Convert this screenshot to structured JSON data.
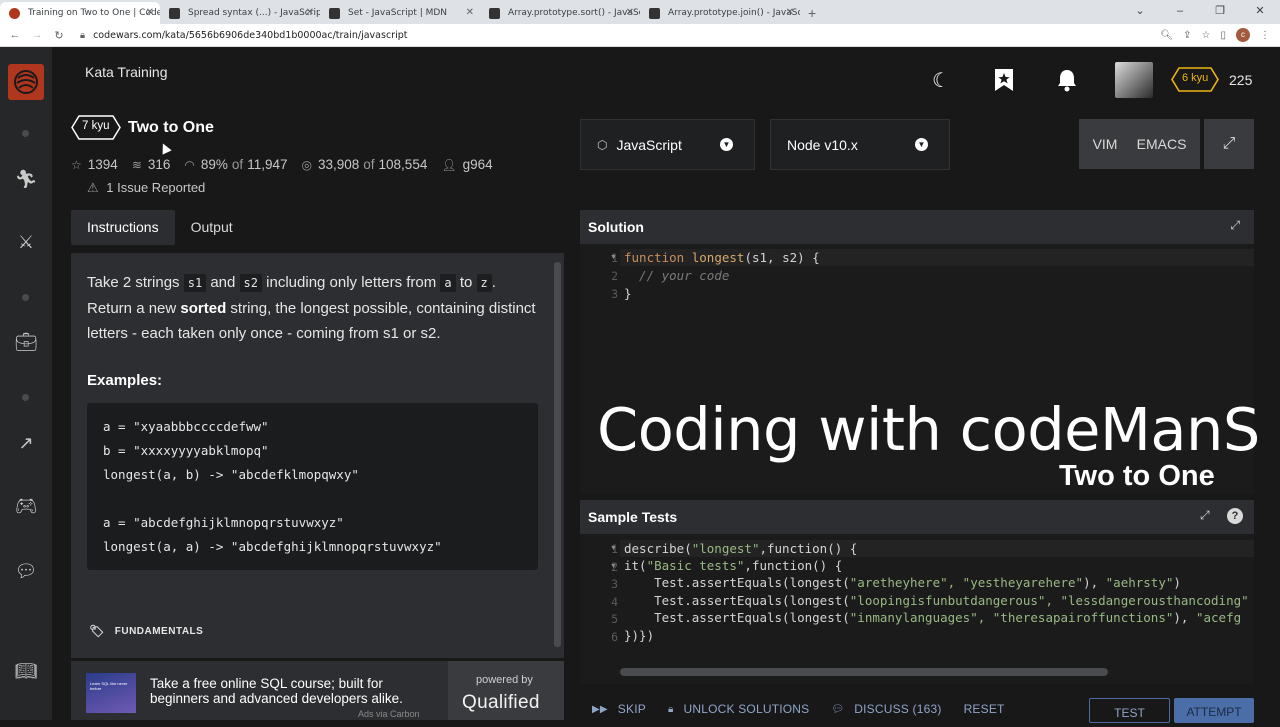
{
  "browser": {
    "tabs": [
      {
        "title": "Training on Two to One | Codewars",
        "active": true
      },
      {
        "title": "Spread syntax (...) - JavaScript | MDN",
        "active": false
      },
      {
        "title": "Set - JavaScript | MDN",
        "active": false
      },
      {
        "title": "Array.prototype.sort() - JavaScript",
        "active": false
      },
      {
        "title": "Array.prototype.join() - JavaScript",
        "active": false
      }
    ],
    "url": "codewars.com/kata/5656b6906de340bd1b0000ac/train/javascript",
    "profile_initial": "c"
  },
  "header": {
    "section_title": "Kata Training",
    "rank": "6 kyu",
    "honor": "225"
  },
  "kata": {
    "kyu": "7 kyu",
    "name": "Two to One",
    "stars": "1394",
    "collections": "316",
    "satisfaction": "89%",
    "satisfaction_of": "of",
    "satisfaction_votes": "11,947",
    "completed": "33,908",
    "completed_of": "of",
    "attempted": "108,554",
    "author": "g964",
    "issues": "1 Issue Reported"
  },
  "left_tabs": {
    "instructions": "Instructions",
    "output": "Output"
  },
  "description": {
    "p1_a": "Take 2 strings ",
    "s1": "s1",
    "p1_b": " and ",
    "s2": "s2",
    "p1_c": " including only letters from ",
    "a": "a",
    "p1_d": " to ",
    "z": "z",
    "p1_e": ".",
    "p2_a": "Return a new ",
    "p2_bold": "sorted",
    "p2_b": " string, the longest possible, containing distinct letters - each taken only once - coming from s1 or s2.",
    "examples_heading": "Examples:",
    "example_code": "a = \"xyaabbbccccdefww\"\nb = \"xxxxyyyyabklmopq\"\nlongest(a, b) -> \"abcdefklmopqwxy\"\n\na = \"abcdefghijklmnopqrstuvwxyz\"\nlongest(a, a) -> \"abcdefghijklmnopqrstuvwxyz\"",
    "tag": "FUNDAMENTALS"
  },
  "ad": {
    "text": "Take a free online SQL course; built for beginners and advanced developers alike.",
    "via": "Ads via Carbon",
    "image_text": "Learn SQL like never before",
    "powered_by": "powered by",
    "brand": "Qualified"
  },
  "editor_bar": {
    "language": "JavaScript",
    "version": "Node v10.x",
    "vim": "VIM",
    "emacs": "EMACS"
  },
  "solution": {
    "title": "Solution",
    "line1_kw": "function",
    "line1_fn": " longest",
    "line1_rest": "(s1, s2) {",
    "line2": "  // your code",
    "line3": "}"
  },
  "overlay": {
    "line1": "Coding with codeManS",
    "line2": "Two to One"
  },
  "sample_tests": {
    "title": "Sample Tests",
    "lines": [
      [
        "describe(",
        "\"longest\"",
        ",function() {"
      ],
      [
        "it(",
        "\"Basic tests\"",
        ",function() {"
      ],
      [
        "    Test.assertEquals(longest(",
        "\"aretheyhere\", \"yestheyarehere\"",
        "), ",
        "\"aehrsty\"",
        ")"
      ],
      [
        "    Test.assertEquals(longest(",
        "\"loopingisfunbutdangerous\", \"lessdangerousthancoding\"",
        ""
      ],
      [
        "    Test.assertEquals(longest(",
        "\"inmanylanguages\", \"theresapairoffunctions\"",
        "), ",
        "\"acefg",
        ""
      ],
      [
        "})})"
      ]
    ]
  },
  "actions": {
    "skip": "SKIP",
    "unlock": "UNLOCK SOLUTIONS",
    "discuss": "DISCUSS (163)",
    "reset": "RESET",
    "test": "TEST",
    "attempt": "ATTEMPT"
  },
  "colors": {
    "brand_red": "#b1361e",
    "rank_yellow": "#ecb613",
    "background": "#181818",
    "panel": "#2d2e31"
  }
}
